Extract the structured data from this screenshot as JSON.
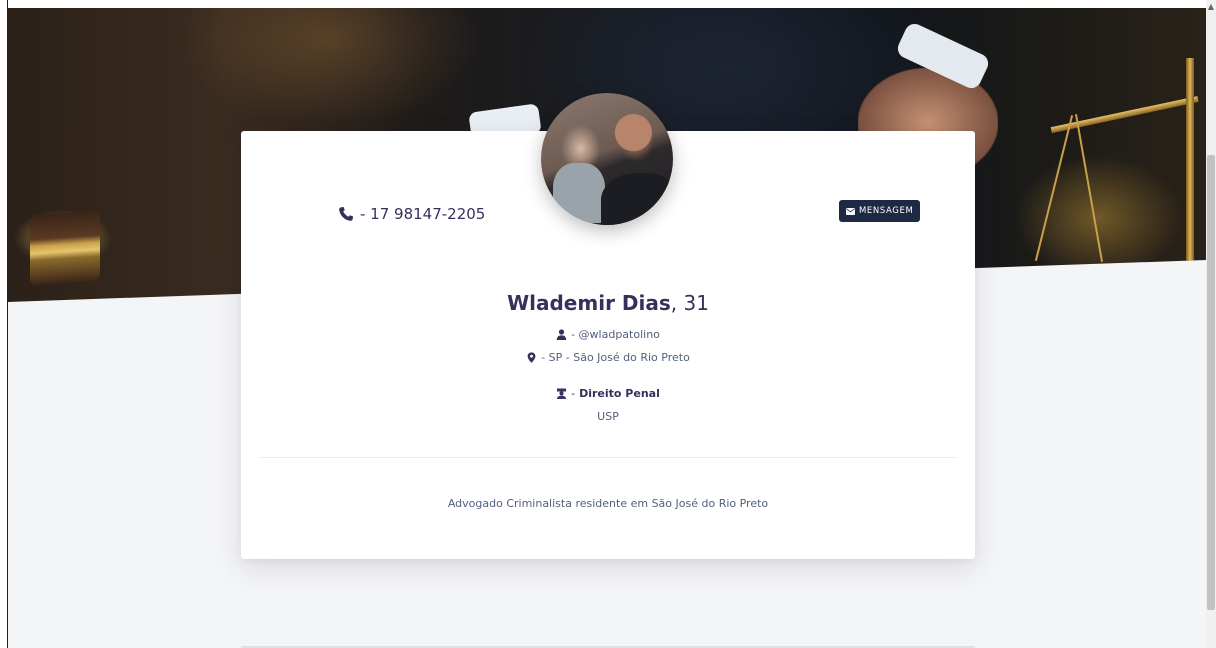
{
  "profile": {
    "name": "Wlademir Dias",
    "age_suffix": ", 31",
    "phone": "- 17 98147-2205",
    "username": "- @wladpatolino",
    "location": "- SP - São José do Rio Preto",
    "area_prefix": " - ",
    "area": "Direito Penal",
    "school": "USP",
    "bio": "Advogado Criminalista residente em São José do Rio Preto"
  },
  "actions": {
    "message_label": "MENSAGEM"
  },
  "icons": {
    "phone": "phone-icon",
    "message": "envelope-icon",
    "user": "user-icon",
    "location": "map-marker-icon",
    "area": "graduate-icon"
  },
  "colors": {
    "primary_text": "#32325d",
    "button_bg": "#1e2a44",
    "page_bg": "#f4f5f7"
  }
}
